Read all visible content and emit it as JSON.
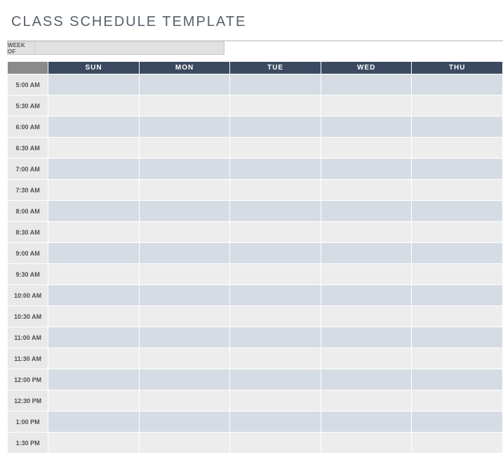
{
  "title": "CLASS SCHEDULE TEMPLATE",
  "weekof": {
    "label": "WEEK OF",
    "value": ""
  },
  "days": [
    "SUN",
    "MON",
    "TUE",
    "WED",
    "THU"
  ],
  "times": [
    "5:00 AM",
    "5:30 AM",
    "6:00 AM",
    "6:30 AM",
    "7:00 AM",
    "7:30 AM",
    "8:00 AM",
    "8:30 AM",
    "9:00 AM",
    "9:30 AM",
    "10:00 AM",
    "10:30 AM",
    "11:00 AM",
    "11:30 AM",
    "12:00 PM",
    "12:30 PM",
    "1:00 PM",
    "1:30 PM"
  ],
  "cells": {}
}
